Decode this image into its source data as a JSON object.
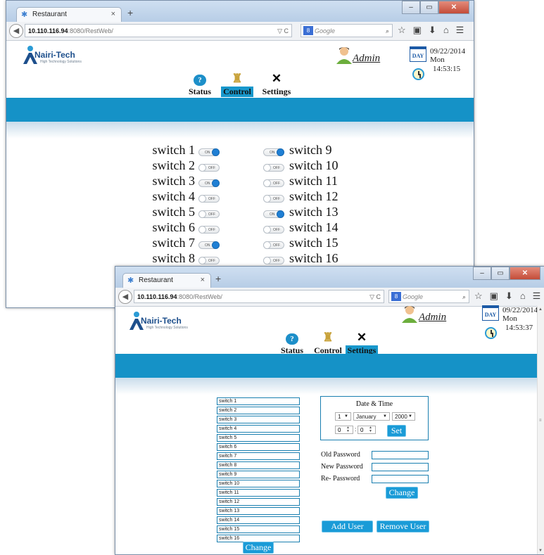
{
  "colors": {
    "accent": "#1592c7",
    "toggle_on": "#1f7fd4",
    "button": "#1a9bd7"
  },
  "window1": {
    "tab_title": "Restaurant",
    "tab_close": "×",
    "new_tab": "+",
    "url_host": "10.110.116.94",
    "url_path": ":8080/RestWeb/",
    "search_placeholder": "Google",
    "user": "Admin",
    "date": "09/22/2014",
    "dow": "Mon",
    "time": "14:53:15",
    "day_icon_text": "DAY",
    "logo_name": "Nairi-Tech",
    "logo_sub": "High Technology Solutions",
    "menu": {
      "status": "Status",
      "control": "Control",
      "settings": "Settings"
    },
    "switches": [
      {
        "label": "switch 1",
        "state": "ON"
      },
      {
        "label": "switch 2",
        "state": "OFF"
      },
      {
        "label": "switch 3",
        "state": "ON"
      },
      {
        "label": "switch 4",
        "state": "OFF"
      },
      {
        "label": "switch 5",
        "state": "OFF"
      },
      {
        "label": "switch 6",
        "state": "OFF"
      },
      {
        "label": "switch 7",
        "state": "ON"
      },
      {
        "label": "switch 8",
        "state": "OFF"
      },
      {
        "label": "switch 9",
        "state": "ON"
      },
      {
        "label": "switch 10",
        "state": "OFF"
      },
      {
        "label": "switch 11",
        "state": "OFF"
      },
      {
        "label": "switch 12",
        "state": "OFF"
      },
      {
        "label": "switch 13",
        "state": "ON"
      },
      {
        "label": "switch 14",
        "state": "OFF"
      },
      {
        "label": "switch 15",
        "state": "OFF"
      },
      {
        "label": "switch 16",
        "state": "OFF"
      }
    ]
  },
  "window2": {
    "tab_title": "Restaurant",
    "tab_close": "×",
    "new_tab": "+",
    "url_host": "10.110.116.94",
    "url_path": ":8080/RestWeb/",
    "search_placeholder": "Google",
    "user": "Admin",
    "date": "09/22/2014",
    "dow": "Mon",
    "time": "14:53:37",
    "day_icon_text": "DAY",
    "logo_name": "Nairi-Tech",
    "logo_sub": "High Technology Solutions",
    "menu": {
      "status": "Status",
      "control": "Control",
      "settings": "Settings"
    },
    "switch_names": [
      "switch 1",
      "switch 2",
      "switch 3",
      "switch 4",
      "switch 5",
      "switch 6",
      "switch 7",
      "switch 8",
      "switch 9",
      "switch 10",
      "switch 11",
      "switch 12",
      "switch 13",
      "switch 14",
      "switch 15",
      "switch 16"
    ],
    "change_names_button": "Change",
    "datetime": {
      "title": "Date & Time",
      "day": "1",
      "month": "January",
      "year": "2000",
      "hour": "0",
      "minute": "0",
      "set_button": "Set"
    },
    "password": {
      "old_label": "Old Password",
      "new_label": "New Password",
      "re_label": "Re- Password",
      "change_button": "Change"
    },
    "add_user_button": "Add User",
    "remove_user_button": "Remove User"
  }
}
